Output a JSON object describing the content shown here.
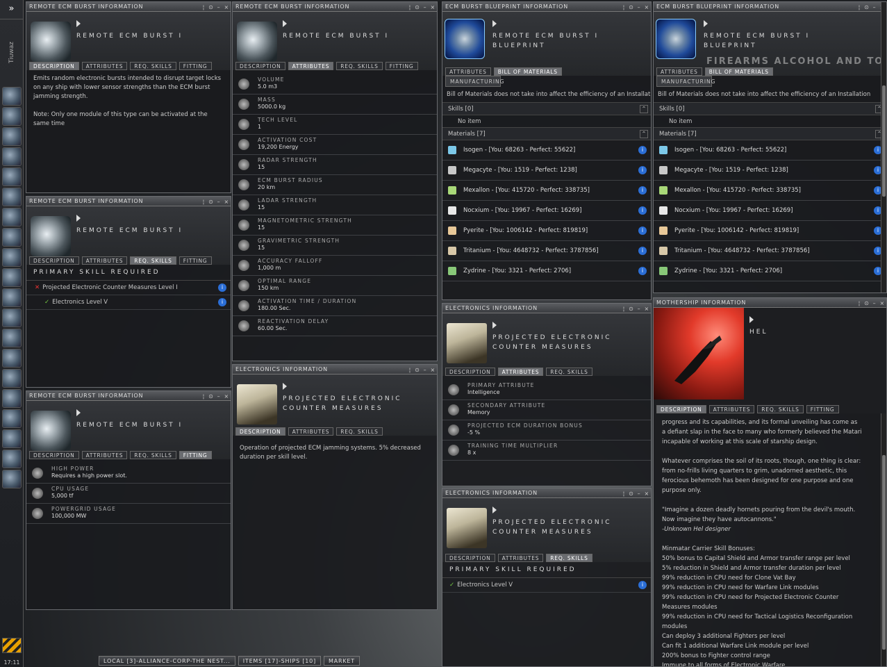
{
  "sidebar": {
    "menu_icon": "»",
    "user": "Tiuwaz",
    "clock": "17:11",
    "icons": [
      "character-sheet-icon",
      "people-icon",
      "mail-icon",
      "notepad-icon",
      "assets-icon",
      "wallet-icon",
      "contracts-icon",
      "map-icon",
      "star-icon",
      "cargo-icon",
      "science-icon",
      "calculator-icon",
      "help-icon",
      "channels-icon",
      "journal-icon",
      "audio-icon",
      "support-icon",
      "portrait-icon",
      "ship-icon",
      "fitting-icon"
    ]
  },
  "controls": [
    "¦",
    "⊙",
    "–",
    "×"
  ],
  "taskbar": [
    "LOCAL [3]-ALLIANCE-CORP-THE NEST...",
    "ITEMS [17]-SHIPS [10]",
    "MARKET"
  ],
  "w1": {
    "title": "REMOTE ECM BURST INFORMATION",
    "name": "REMOTE ECM BURST I",
    "tabs": [
      "DESCRIPTION",
      "ATTRIBUTES",
      "REQ. SKILLS",
      "FITTING"
    ],
    "desc1": "Emits random electronic bursts intended to disrupt target locks on any ship with lower sensor strengths than the ECM burst jamming strength.",
    "desc2": "Note: Only one module of this type can be activated at the same time"
  },
  "w2": {
    "title": "REMOTE ECM BURST INFORMATION",
    "name": "REMOTE ECM BURST I",
    "tabs": [
      "DESCRIPTION",
      "ATTRIBUTES",
      "REQ. SKILLS",
      "FITTING"
    ],
    "attrs": [
      {
        "l": "VOLUME",
        "v": "5.0 m3"
      },
      {
        "l": "MASS",
        "v": "5000.0 kg"
      },
      {
        "l": "TECH LEVEL",
        "v": "1"
      },
      {
        "l": "ACTIVATION COST",
        "v": "19,200 Energy"
      },
      {
        "l": "RADAR STRENGTH",
        "v": "15"
      },
      {
        "l": "ECM BURST RADIUS",
        "v": "20 km"
      },
      {
        "l": "LADAR STRENGTH",
        "v": "15"
      },
      {
        "l": "MAGNETOMETRIC STRENGTH",
        "v": "15"
      },
      {
        "l": "GRAVIMETRIC STRENGTH",
        "v": "15"
      },
      {
        "l": "ACCURACY FALLOFF",
        "v": "1,000 m"
      },
      {
        "l": "OPTIMAL RANGE",
        "v": "150 km"
      },
      {
        "l": "ACTIVATION TIME / DURATION",
        "v": "180.00 Sec."
      },
      {
        "l": "REACTIVATION DELAY",
        "v": "60.00 Sec."
      }
    ]
  },
  "w3": {
    "title": "ECM BURST BLUEPRINT INFORMATION",
    "name": "REMOTE ECM BURST I BLUEPRINT",
    "tabs": [
      "ATTRIBUTES",
      "BILL OF MATERIALS"
    ],
    "sub": "MANUFACTURING",
    "note": "Bill of Materials does not take into affect the efficiency of an Installation",
    "skills": "Skills [0]",
    "noitem": "No item",
    "mats_h": "Materials [7]",
    "mats": [
      "Isogen - [You: 68263 - Perfect: 55622]",
      "Megacyte - [You: 1519 - Perfect: 1238]",
      "Mexallon - [You: 415720 - Perfect: 338735]",
      "Nocxium - [You: 19967 - Perfect: 16269]",
      "Pyerite - [You: 1006142 - Perfect: 819819]",
      "Tritanium - [You: 4648732 - Perfect: 3787856]",
      "Zydrine - [You: 3321 - Perfect: 2706]"
    ],
    "mat_colors": [
      "#7cc8e8",
      "#c8c8c8",
      "#a8d878",
      "#e8e8e8",
      "#e8c898",
      "#d8c8a8",
      "#88c878"
    ]
  },
  "w4": {
    "title": "ECM BURST BLUEPRINT INFORMATION",
    "name": "REMOTE ECM BURST I BLUEPRINT",
    "tabs": [
      "ATTRIBUTES",
      "BILL OF MATERIALS"
    ],
    "sub": "MANUFACTURING",
    "note": "Bill of Materials does not take into affect the efficiency of an Installation",
    "ghost": "FIREARMS ALCOHOL AND TOBACCO"
  },
  "w5": {
    "title": "REMOTE ECM BURST INFORMATION",
    "name": "REMOTE ECM BURST I",
    "tabs": [
      "DESCRIPTION",
      "ATTRIBUTES",
      "REQ. SKILLS",
      "FITTING"
    ],
    "head": "PRIMARY SKILL REQUIRED",
    "s1": "Projected Electronic Counter Measures Level I",
    "s2": "Electronics Level V"
  },
  "w6": {
    "title": "ELECTRONICS INFORMATION",
    "name": "PROJECTED ELECTRONIC COUNTER MEASURES",
    "tabs": [
      "DESCRIPTION",
      "ATTRIBUTES",
      "REQ. SKILLS"
    ],
    "desc": "Operation of projected ECM jamming systems. 5% decreased duration per skill level."
  },
  "w7": {
    "title": "ELECTRONICS INFORMATION",
    "name": "PROJECTED ELECTRONIC COUNTER MEASURES",
    "tabs": [
      "DESCRIPTION",
      "ATTRIBUTES",
      "REQ. SKILLS"
    ],
    "attrs": [
      {
        "l": "PRIMARY ATTRIBUTE",
        "v": "Intelligence"
      },
      {
        "l": "SECONDARY ATTRIBUTE",
        "v": "Memory"
      },
      {
        "l": "PROJECTED ECM DURATION BONUS",
        "v": "-5 %"
      },
      {
        "l": "TRAINING TIME MULTIPLIER",
        "v": "8 x"
      }
    ]
  },
  "w8": {
    "title": "MOTHERSHIP INFORMATION",
    "name": "HEL",
    "tabs": [
      "DESCRIPTION",
      "ATTRIBUTES",
      "REQ. SKILLS",
      "FITTING"
    ],
    "lines": [
      "progress and its capabilities, and its formal unveiling has come as",
      "a defiant slap in the face to many who formerly believed the Matari",
      "incapable of working at this scale of starship design.",
      "",
      "Whatever comprises the soil of its roots, though, one thing is clear:",
      "from no-frills living quarters to grim, unadorned aesthetic, this",
      "ferocious behemoth has been designed for one purpose and one",
      "purpose only.",
      "",
      "\"Imagine a dozen deadly hornets pouring from the devil's mouth.",
      "Now imagine they have autocannons.\"",
      "-Unknown Hel designer",
      "",
      "Minmatar Carrier Skill Bonuses:",
      "50% bonus to Capital Shield and Armor transfer range per level",
      "5% reduction in Shield and Armor transfer duration per level",
      "99% reduction in CPU need for Clone Vat Bay",
      "99% reduction in CPU need for Warfare Link modules",
      "99% reduction in CPU need for Projected Electronic Counter",
      "Measures modules",
      "99% reduction in CPU need for Tactical Logistics Reconfiguration",
      "modules",
      "Can deploy 3 additional Fighters per level",
      "Can fit 1 additional Warfare Link module per level",
      "200% bonus to Fighter control range",
      "Immune to all forms of Electronic Warfare"
    ]
  },
  "w9": {
    "title": "REMOTE ECM BURST INFORMATION",
    "name": "REMOTE ECM BURST I",
    "tabs": [
      "DESCRIPTION",
      "ATTRIBUTES",
      "REQ. SKILLS",
      "FITTING"
    ],
    "fit": [
      {
        "l": "HIGH POWER",
        "v": "Requires a high power slot."
      },
      {
        "l": "CPU USAGE",
        "v": "5,000 tf"
      },
      {
        "l": "POWERGRID USAGE",
        "v": "100,000 MW"
      }
    ]
  },
  "w10": {
    "title": "ELECTRONICS INFORMATION",
    "name": "PROJECTED ELECTRONIC COUNTER MEASURES",
    "tabs": [
      "DESCRIPTION",
      "ATTRIBUTES",
      "REQ. SKILLS"
    ],
    "head": "PRIMARY SKILL REQUIRED",
    "s1": "Electronics Level V"
  }
}
